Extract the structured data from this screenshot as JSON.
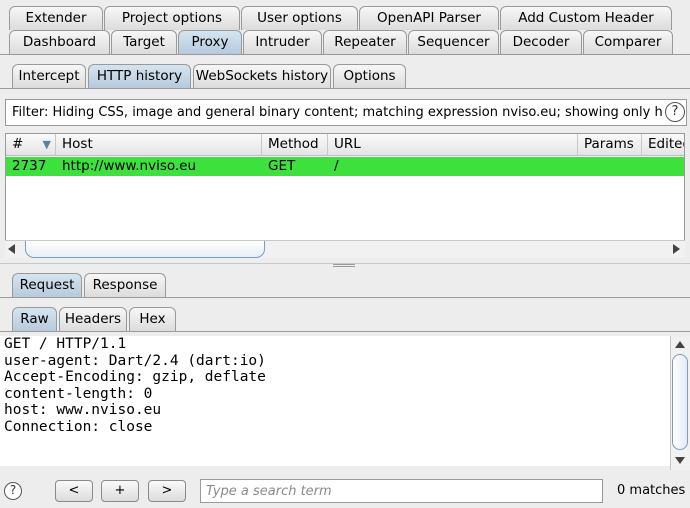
{
  "main_tabs_row1": [
    "Extender",
    "Project options",
    "User options",
    "OpenAPI Parser",
    "Add Custom Header"
  ],
  "main_tabs_row2": [
    "Dashboard",
    "Target",
    "Proxy",
    "Intruder",
    "Repeater",
    "Sequencer",
    "Decoder",
    "Comparer"
  ],
  "proxy_tabs": [
    "Intercept",
    "HTTP history",
    "WebSockets history",
    "Options"
  ],
  "filter_text": "Filter: Hiding CSS, image and general binary content;  matching expression nviso.eu;  showing only high",
  "help_glyph": "?",
  "table": {
    "columns": [
      "#",
      "Host",
      "Method",
      "URL",
      "Params",
      "Edited"
    ],
    "sort_indicator": "▼",
    "rows": [
      {
        "num": "2737",
        "host": "http://www.nviso.eu",
        "method": "GET",
        "url": "/",
        "params": "",
        "edited": ""
      }
    ],
    "row_highlight_color": "#3ee03e"
  },
  "message_tabs": [
    "Request",
    "Response"
  ],
  "view_tabs": [
    "Raw",
    "Headers",
    "Hex"
  ],
  "request_lines": [
    "GET / HTTP/1.1",
    "user-agent: Dart/2.4 (dart:io)",
    "Accept-Encoding: gzip, deflate",
    "content-length: 0",
    "host: www.nviso.eu",
    "Connection: close"
  ],
  "bottom_bar": {
    "prev_label": "<",
    "add_label": "+",
    "next_label": ">",
    "search_placeholder": "Type a search term",
    "matches": "0 matches"
  }
}
